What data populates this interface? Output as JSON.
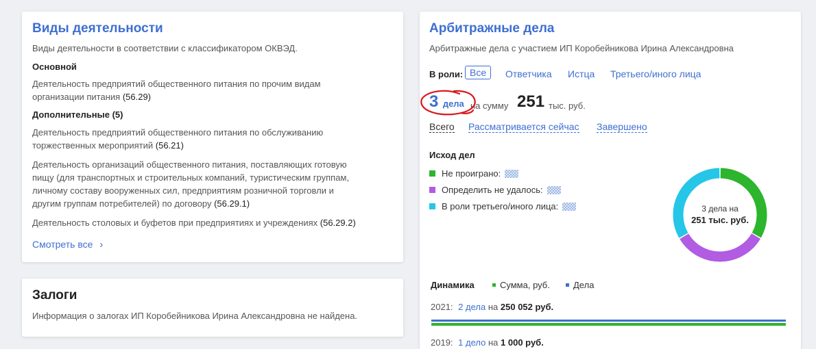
{
  "activities": {
    "title": "Виды деятельности",
    "subtitle": "Виды деятельности в соответствии с классификатором ОКВЭД.",
    "main_label": "Основной",
    "main_line1": "Деятельность предприятий общественного питания по прочим видам",
    "main_line2": "организации питания",
    "main_code": "(56.29)",
    "additional_label": "Дополнительные (5)",
    "item1_line1": "Деятельность предприятий общественного питания по обслуживанию",
    "item1_line2": "торжественных мероприятий",
    "item1_code": "(56.21)",
    "item2_line1": "Деятельность организаций общественного питания, поставляющих готовую",
    "item2_line2": "пищу (для транспортных и строительных компаний, туристическим группам,",
    "item2_line3": "личному составу вооруженных сил, предприятиям розничной торговли и",
    "item2_line4": "другим группам потребителей) по договору",
    "item2_code": "(56.29.1)",
    "item3_line1": "Деятельность столовых и буфетов при предприятиях и учреждениях",
    "item3_code": "(56.29.2)",
    "see_all": "Смотреть все",
    "see_all_chevron": "›"
  },
  "pledges": {
    "title": "Залоги",
    "text": "Информация о залогах ИП Коробейникова Ирина Александровна не найдена."
  },
  "arbitration": {
    "title": "Арбитражные дела",
    "subtitle": "Арбитражные дела с участием ИП Коробейникова Ирина Александровна",
    "role_label": "В роли:",
    "roles": [
      "Все",
      "Ответчика",
      "Истца",
      "Третьего/иного лица"
    ],
    "count_num": "3",
    "count_word": "дела",
    "sum_prefix": "на сумму",
    "sum_value": "251",
    "sum_unit": "тыс. руб.",
    "filters": [
      "Всего",
      "Рассматривается сейчас",
      "Завершено"
    ],
    "outcome_title": "Исход дел",
    "outcomes": [
      {
        "label": "Не проиграно:",
        "color": "#2db52d"
      },
      {
        "label": "Определить не удалось:",
        "color": "#b25be3"
      },
      {
        "label": "В роли третьего/иного лица:",
        "color": "#25c6e8"
      }
    ],
    "donut_line1": "3 дела на",
    "donut_line2": "251 тыс. руб.",
    "donut_segments": [
      {
        "name": "Не проиграно",
        "fraction": 0.333,
        "color": "#2db52d"
      },
      {
        "name": "Определить не удалось",
        "fraction": 0.333,
        "color": "#b25be3"
      },
      {
        "name": "В роли третьего/иного лица",
        "fraction": 0.334,
        "color": "#25c6e8"
      }
    ],
    "dynamics_title": "Динамика",
    "dyn_legend_sum": "Сумма, руб.",
    "dyn_legend_cases": "Дела",
    "dyn_sum_color": "#2db52d",
    "dyn_cases_color": "#3e6fd1",
    "rows": [
      {
        "year": "2021:",
        "cases": "2 дела",
        "on": "на",
        "amount": "250 052 руб."
      },
      {
        "year": "2019:",
        "cases": "1 дело",
        "on": "на",
        "amount": "1 000 руб."
      }
    ]
  },
  "annotation_color": "#d9191c"
}
